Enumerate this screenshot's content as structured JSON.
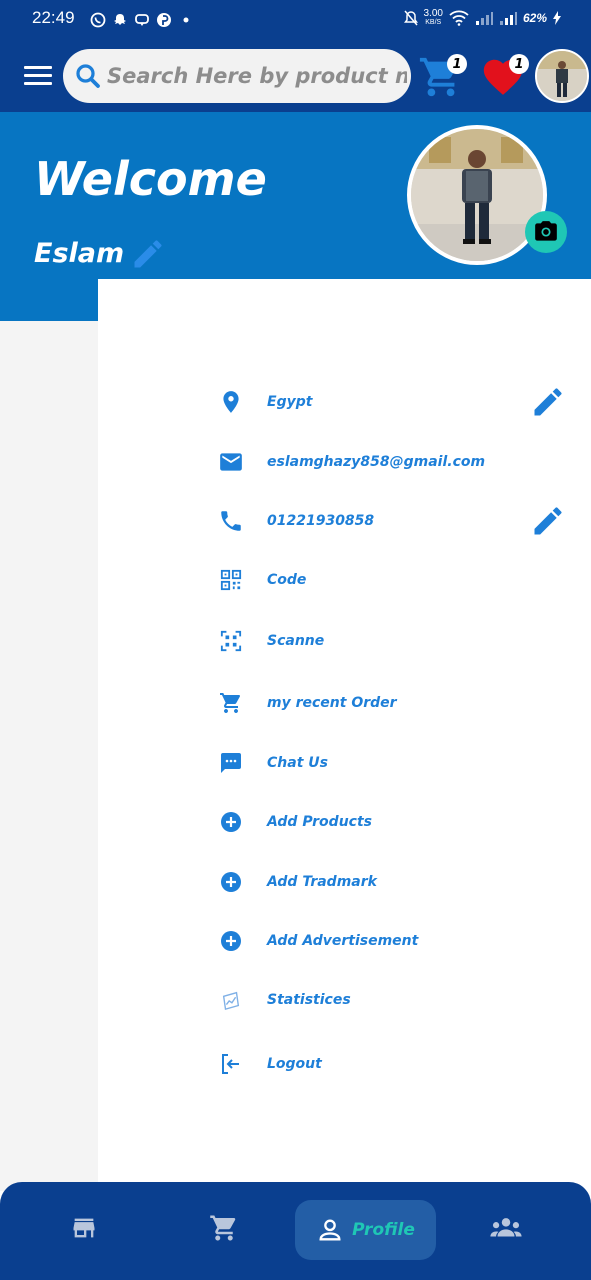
{
  "status_bar": {
    "time": "22:49",
    "net_speed_value": "3.00",
    "net_speed_unit": "KB/S",
    "battery": "62%"
  },
  "app_bar": {
    "search_placeholder": "Search Here by product name or",
    "cart_count": "1",
    "favorites_count": "1"
  },
  "header": {
    "welcome": "Welcome",
    "user_name": "Eslam"
  },
  "menu": [
    {
      "label": "Egypt",
      "icon": "location-icon",
      "editable": true
    },
    {
      "label": "eslamghazy858@gmail.com",
      "icon": "email-icon",
      "editable": false
    },
    {
      "label": "01221930858",
      "icon": "phone-icon",
      "editable": true
    },
    {
      "label": "Code",
      "icon": "qr-code-icon",
      "editable": false
    },
    {
      "label": "Scanne",
      "icon": "qr-scanner-icon",
      "editable": false
    },
    {
      "label": "my recent Order",
      "icon": "cart-icon",
      "editable": false
    },
    {
      "label": "Chat Us",
      "icon": "chat-icon",
      "editable": false
    },
    {
      "label": "Add Products",
      "icon": "add-circle-icon",
      "editable": false
    },
    {
      "label": "Add Tradmark",
      "icon": "add-circle-icon",
      "editable": false
    },
    {
      "label": "Add Advertisement",
      "icon": "add-circle-icon",
      "editable": false
    },
    {
      "label": "Statistices",
      "icon": "statistics-icon",
      "editable": false
    },
    {
      "label": "Logout",
      "icon": "logout-icon",
      "editable": false
    }
  ],
  "bottom_nav": {
    "active_label": "Profile",
    "items": [
      "store-icon",
      "cart-icon",
      "profile-icon",
      "group-icon"
    ]
  },
  "colors": {
    "primary_dark": "#0a3f8f",
    "primary": "#0775c2",
    "accent_text": "#1e7fd8",
    "teal": "#1fc7b5"
  }
}
